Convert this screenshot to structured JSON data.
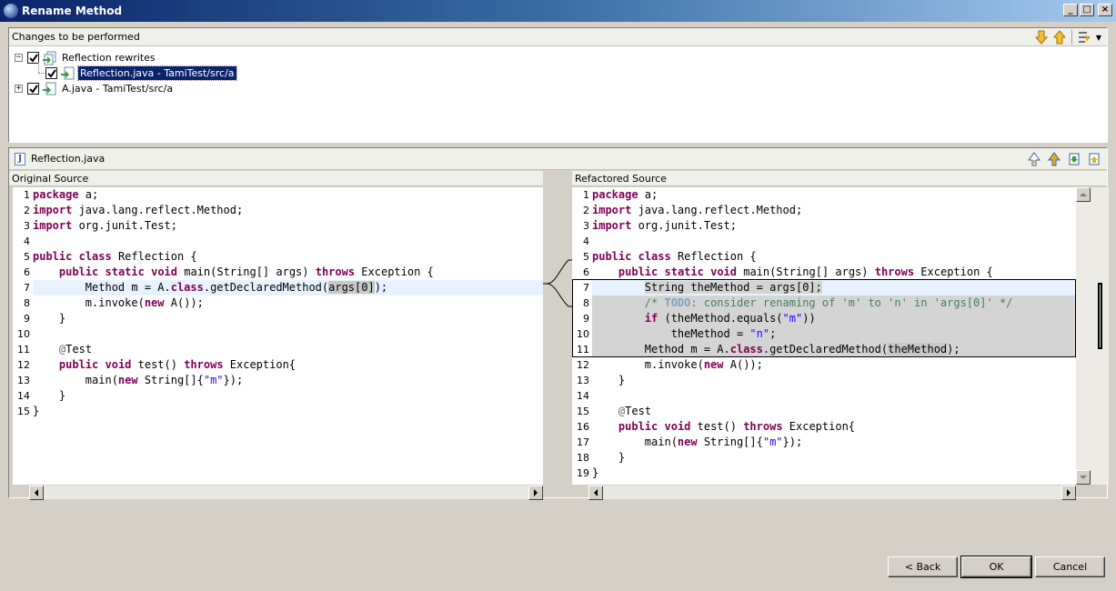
{
  "window": {
    "title": "Rename Method",
    "controls": {
      "minimize": "_",
      "maximize": "□",
      "close": "×"
    }
  },
  "changes": {
    "header": "Changes to be performed",
    "tree": [
      {
        "label": "Reflection rewrites",
        "expander": "−",
        "checked": true,
        "selected": false,
        "level": 0
      },
      {
        "label": "Reflection.java - TamiTest/src/a",
        "expander": "",
        "checked": true,
        "selected": true,
        "level": 1
      },
      {
        "label": "A.java - TamiTest/src/a",
        "expander": "+",
        "checked": true,
        "selected": false,
        "level": 0
      }
    ],
    "icons": [
      "next-change-down-arrow-icon",
      "previous-change-up-arrow-icon",
      "filter-icon",
      "view-menu-chevron-icon"
    ]
  },
  "compare": {
    "file": "Reflection.java",
    "left_title": "Original Source",
    "right_title": "Refactored Source",
    "icons": [
      "copy-all-left-to-right-icon",
      "copy-current-change-icon",
      "next-difference-icon",
      "previous-difference-icon"
    ],
    "left_lines": [
      {
        "n": "1",
        "html": "<span class=\"kw\">package</span> a;"
      },
      {
        "n": "2",
        "html": "<span class=\"kw\">import</span> java.lang.reflect.Method;"
      },
      {
        "n": "3",
        "html": "<span class=\"kw\">import</span> org.junit.Test;"
      },
      {
        "n": "4",
        "html": ""
      },
      {
        "n": "5",
        "html": "<span class=\"kw\">public</span> <span class=\"kw\">class</span> Reflection {"
      },
      {
        "n": "6",
        "html": "    <span class=\"kw\">public</span> <span class=\"kw\">static</span> <span class=\"kw\">void</span> main(String[] args) <span class=\"kw\">throws</span> Exception {"
      },
      {
        "n": "7",
        "html": "        Method m = A.<span class=\"kw\">class</span>.getDeclaredMethod(<span class=\"mark-word\">args[0]</span>);",
        "cls": "hl-line"
      },
      {
        "n": "8",
        "html": "        m.invoke(<span class=\"kw\">new</span> A());"
      },
      {
        "n": "9",
        "html": "    }"
      },
      {
        "n": "10",
        "html": ""
      },
      {
        "n": "11",
        "html": "    <span class=\"ann\">@</span>Test"
      },
      {
        "n": "12",
        "html": "    <span class=\"kw\">public</span> <span class=\"kw\">void</span> test() <span class=\"kw\">throws</span> Exception{"
      },
      {
        "n": "13",
        "html": "        main(<span class=\"kw\">new</span> String[]{<span class=\"str\">\"m\"</span>});"
      },
      {
        "n": "14",
        "html": "    }"
      },
      {
        "n": "15",
        "html": "}"
      }
    ],
    "right_lines": [
      {
        "n": "1",
        "html": "<span class=\"kw\">package</span> a;"
      },
      {
        "n": "2",
        "html": "<span class=\"kw\">import</span> java.lang.reflect.Method;"
      },
      {
        "n": "3",
        "html": "<span class=\"kw\">import</span> org.junit.Test;"
      },
      {
        "n": "4",
        "html": ""
      },
      {
        "n": "5",
        "html": "<span class=\"kw\">public</span> <span class=\"kw\">class</span> Reflection {"
      },
      {
        "n": "6",
        "html": "    <span class=\"kw\">public</span> <span class=\"kw\">static</span> <span class=\"kw\">void</span> main(String[] args) <span class=\"kw\">throws</span> Exception {"
      },
      {
        "n": "7",
        "html": "        <span class=\"changed\">String theMethod = args[0];</span>",
        "cls": "hl-line"
      },
      {
        "n": "8",
        "html": "        <span class=\"changed\"><span class=\"cm\">/* </span><span class=\"todo\">TODO</span><span class=\"cm\">: consider renaming of 'm' to 'n' in 'args[0]' */</span></span>",
        "cls": "changed"
      },
      {
        "n": "9",
        "html": "        <span class=\"changed\"><span class=\"kw\">if</span> (theMethod.equals(<span class=\"str\">\"m\"</span>))</span>",
        "cls": "changed"
      },
      {
        "n": "10",
        "html": "            <span class=\"changed\">theMethod = <span class=\"str\">\"n\"</span>;</span>",
        "cls": "changed"
      },
      {
        "n": "11",
        "html": "        Method m = A.<span class=\"kw\">class</span>.getDeclaredMethod(<span class=\"mark-word\">theMethod</span>);",
        "cls": "changed"
      },
      {
        "n": "12",
        "html": "        m.invoke(<span class=\"kw\">new</span> A());"
      },
      {
        "n": "13",
        "html": "    }"
      },
      {
        "n": "14",
        "html": ""
      },
      {
        "n": "15",
        "html": "    <span class=\"ann\">@</span>Test"
      },
      {
        "n": "16",
        "html": "    <span class=\"kw\">public</span> <span class=\"kw\">void</span> test() <span class=\"kw\">throws</span> Exception{"
      },
      {
        "n": "17",
        "html": "        main(<span class=\"kw\">new</span> String[]{<span class=\"str\">\"m\"</span>});"
      },
      {
        "n": "18",
        "html": "    }"
      },
      {
        "n": "19",
        "html": "}"
      }
    ]
  },
  "buttons": {
    "back": "< Back",
    "ok": "OK",
    "cancel": "Cancel"
  }
}
